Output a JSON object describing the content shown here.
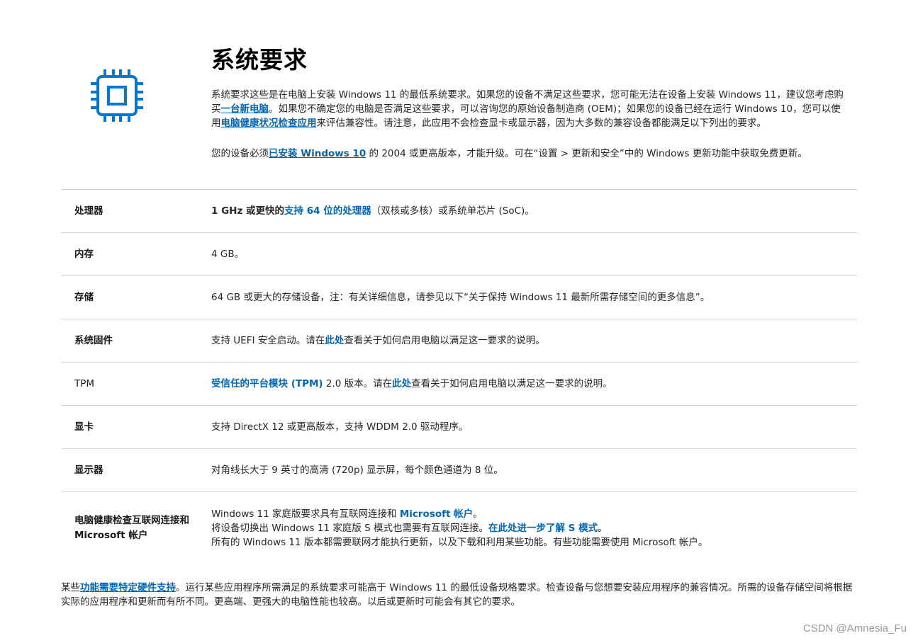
{
  "title": "系统要求",
  "intro": {
    "p1_a": "系统要求这些是在电脑上安装 Windows 11 的最低系统要求。如果您的设备不满足这些要求，您可能无法在设备上安装 Windows 11，建议您考虑购买",
    "p1_link1": "一台新电脑",
    "p1_b": "。如果您不确定您的电脑是否满足这些要求，可以咨询您的原始设备制造商 (OEM)；如果您的设备已经在运行 Windows 10，您可以使用",
    "p1_link2": "电脑健康状况检查应用",
    "p1_c": "来评估兼容性。请注意，此应用不会检查显卡或显示器，因为大多数的兼容设备都能满足以下列出的要求。",
    "p2_a": "您的设备必须",
    "p2_link": "已安装 Windows 10",
    "p2_b": " 的 2004 或更高版本，才能升级。可在“设置 > 更新和安全”中的 Windows 更新功能中获取免费更新。"
  },
  "requirements": {
    "cpu": {
      "label": "处理器",
      "pre": "1 GHz 或更快的",
      "link": "支持 64 位的处理器",
      "post": "（双核或多核）或系统单芯片 (SoC)。"
    },
    "ram": {
      "label": "内存",
      "value": "4 GB。"
    },
    "storage": {
      "label": "存储",
      "value": "64 GB 或更大的存储设备，注：有关详细信息，请参见以下“关于保持 Windows 11 最新所需存储空间的更多信息”。"
    },
    "firmware": {
      "label": "系统固件",
      "pre": "支持 UEFI 安全启动。请在",
      "link": "此处",
      "post": "查看关于如何启用电脑以满足这一要求的说明。"
    },
    "tpm": {
      "label": "TPM",
      "link1": "受信任的平台模块 (TPM)",
      "mid": " 2.0 版本。请在",
      "link2": "此处",
      "post": "查看关于如何启用电脑以满足这一要求的说明。"
    },
    "gpu": {
      "label": "显卡",
      "value": "支持 DirectX 12 或更高版本，支持 WDDM 2.0 驱动程序。"
    },
    "display": {
      "label": "显示器",
      "value": "对角线长大于 9 英寸的高清 (720p) 显示屏，每个颜色通道为 8 位。"
    },
    "internet": {
      "label": "电脑健康检查互联网连接和 Microsoft 帐户",
      "line1_pre": "Windows 11 家庭版要求具有互联网连接和 ",
      "line1_link": "Microsoft 帐户",
      "line1_post": "。",
      "line2_pre": "将设备切换出 Windows 11 家庭版 S 模式也需要有互联网连接。",
      "line2_link": "在此处进一步了解 S 模式",
      "line2_post": "。",
      "line3": "所有的 Windows 11 版本都需要联网才能执行更新，以及下载和利用某些功能。有些功能需要使用 Microsoft 帐户。"
    }
  },
  "footer": {
    "pre": "某些",
    "link": "功能需要特定硬件支持",
    "post": "。运行某些应用程序所需满足的系统要求可能高于 Windows 11 的最低设备规格要求。检查设备与您想要安装应用程序的兼容情况。所需的设备存储空间将根据实际的应用程序和更新而有所不同。更高端、更强大的电脑性能也较高。以后或更新时可能会有其它的要求。"
  },
  "watermark": "CSDN @Amnesia_Fu",
  "colors": {
    "accent": "#0067b8",
    "divider": "#d6d6d6"
  },
  "icon": "processor-chip-icon"
}
